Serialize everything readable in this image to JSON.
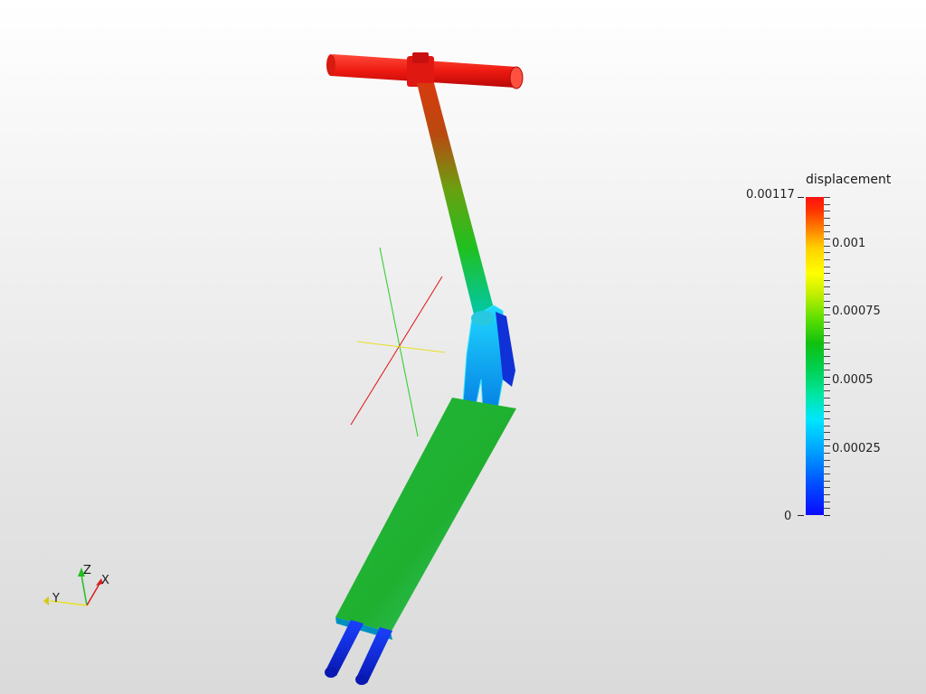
{
  "legend": {
    "title": "displacement",
    "max_label": "0.00117",
    "min_label": "0",
    "labels": [
      "0.001",
      "0.00075",
      "0.0005",
      "0.00025"
    ],
    "colors": {
      "low": "#0a0aff",
      "mid": "#10c010",
      "high": "#ff1010"
    }
  },
  "axes_triad": {
    "x_label": "X",
    "y_label": "Y",
    "z_label": "Z",
    "colors": {
      "x": "#d81e1e",
      "y": "#e8e020",
      "z": "#20c020"
    }
  },
  "scene": {
    "field_colors": {
      "handle": "#ee2a1a",
      "plate": "#20b030",
      "fork": "#00b8ff",
      "wheels": "#1028ff"
    }
  }
}
